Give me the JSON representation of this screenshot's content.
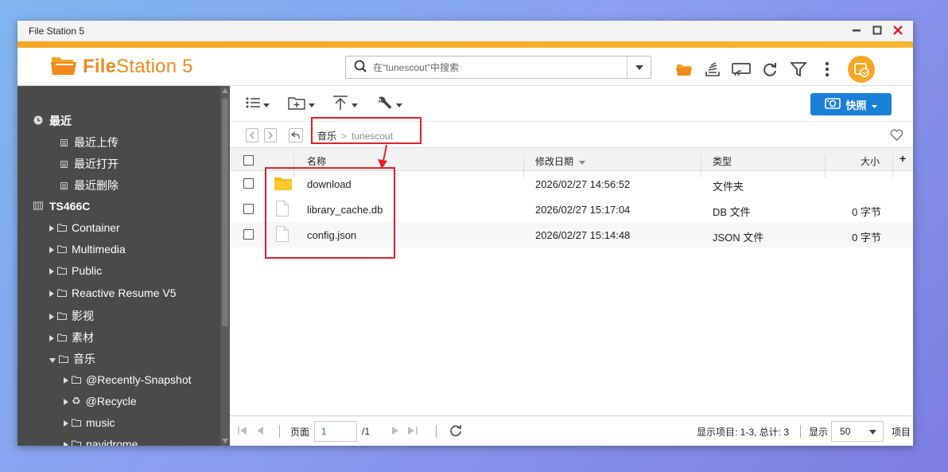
{
  "window": {
    "title": "File Station 5"
  },
  "header": {
    "logo_bold": "File",
    "logo_rest": "Station 5",
    "search_placeholder": "在“tunescout”中搜索"
  },
  "sidebar": {
    "recent": {
      "label": "最近",
      "items": [
        "最近上传",
        "最近打开",
        "最近删除"
      ]
    },
    "nas": {
      "label": "TS466C",
      "folders": [
        "Container",
        "Multimedia",
        "Public",
        "Reactive Resume V5",
        "影视",
        "素材",
        "音乐"
      ],
      "subfolders": [
        "@Recently-Snapshot",
        "@Recycle",
        "music",
        "navidrome"
      ]
    }
  },
  "toolbar": {
    "snapshot_label": "快照"
  },
  "path": {
    "parts": [
      "音乐",
      "tunescout"
    ]
  },
  "table": {
    "columns": [
      "名称",
      "修改日期",
      "类型",
      "大小"
    ],
    "rows": [
      {
        "name": "download",
        "date": "2026/02/27 14:56:52",
        "type": "文件夹",
        "size": "",
        "icon": "folder-icon"
      },
      {
        "name": "library_cache.db",
        "date": "2026/02/27 15:17:04",
        "type": "DB 文件",
        "size": "0 字节",
        "icon": "file-icon"
      },
      {
        "name": "config.json",
        "date": "2026/02/27 15:14:48",
        "type": "JSON 文件",
        "size": "0 字节",
        "icon": "file-icon"
      }
    ]
  },
  "footer": {
    "page_label": "页面",
    "page_value": "1",
    "page_total": "/1",
    "status": "显示项目: 1-3, 总计: 3",
    "show_label": "显示",
    "per_page": "50",
    "items_label": "项目"
  },
  "colors": {
    "accent": "#f6a623",
    "logo": "#f08a1c",
    "primary": "#1a7fd8",
    "highlight": "#e0212b",
    "sidebar": "#4a4a4a"
  }
}
